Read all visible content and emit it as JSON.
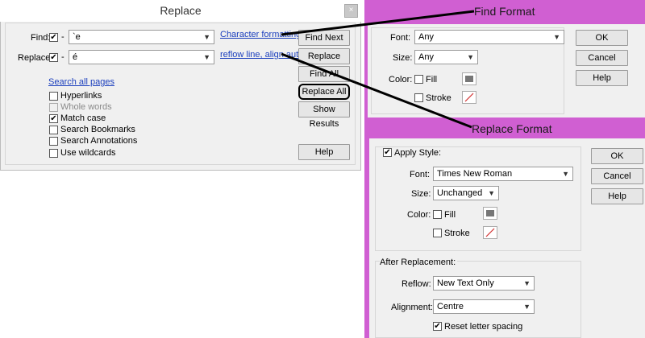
{
  "replace_dialog": {
    "title": "Replace",
    "close_glyph": "×",
    "find_label": "Find:",
    "find_value": "`e",
    "replace_label": "Replace:",
    "replace_value": "é",
    "dash": "-",
    "char_formatting_link": "Character formatting",
    "reflow_link": "reflow line, align auto",
    "search_all_pages_link": "Search all pages",
    "options": [
      {
        "label": "Hyperlinks",
        "checked": false,
        "disabled": false
      },
      {
        "label": "Whole words",
        "checked": false,
        "disabled": true
      },
      {
        "label": "Match case",
        "checked": true,
        "disabled": false
      },
      {
        "label": "Search Bookmarks",
        "checked": false,
        "disabled": false
      },
      {
        "label": "Search Annotations",
        "checked": false,
        "disabled": false
      },
      {
        "label": "Use wildcards",
        "checked": false,
        "disabled": false
      }
    ],
    "buttons": {
      "find_next": "Find Next",
      "replace": "Replace",
      "find_all": "Find All",
      "replace_all": "Replace All",
      "show_results": "Show Results",
      "help": "Help"
    }
  },
  "find_format": {
    "title": "Find Format",
    "font_label": "Font:",
    "font_value": "Any",
    "size_label": "Size:",
    "size_value": "Any",
    "color_label": "Color:",
    "fill_label": "Fill",
    "stroke_label": "Stroke",
    "ok": "OK",
    "cancel": "Cancel",
    "help": "Help"
  },
  "replace_format": {
    "title": "Replace Format",
    "apply_style_label": "Apply Style:",
    "font_label": "Font:",
    "font_value": "Times New Roman",
    "size_label": "Size:",
    "size_value": "Unchanged",
    "color_label": "Color:",
    "fill_label": "Fill",
    "stroke_label": "Stroke",
    "after_replacement_label": "After Replacement:",
    "reflow_label": "Reflow:",
    "reflow_value": "New Text Only",
    "alignment_label": "Alignment:",
    "alignment_value": "Centre",
    "reset_letter_spacing_label": "Reset letter spacing",
    "ok": "OK",
    "cancel": "Cancel",
    "help": "Help"
  },
  "colors": {
    "accent_panel": "#d05fd2",
    "link": "#1a3ebd"
  }
}
